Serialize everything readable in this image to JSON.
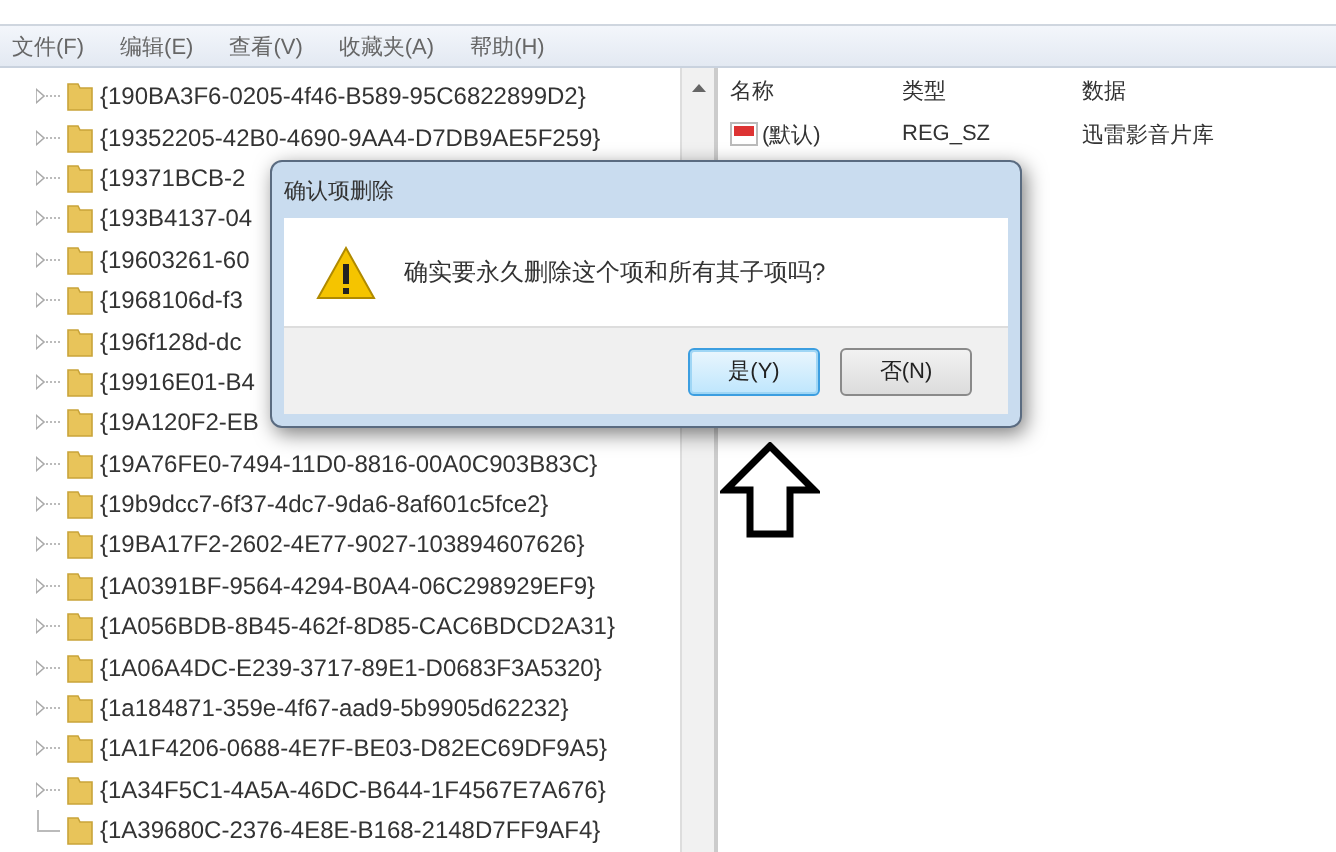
{
  "menu": [
    "文件(F)",
    "编辑(E)",
    "查看(V)",
    "收藏夹(A)",
    "帮助(H)"
  ],
  "tree": {
    "items": [
      {
        "label": "{190BA3F6-0205-4f46-B589-95C6822899D2}",
        "expandable": true
      },
      {
        "label": "{19352205-42B0-4690-9AA4-D7DB9AE5F259}",
        "expandable": true
      },
      {
        "label": "{19371BCB-2",
        "expandable": true
      },
      {
        "label": "{193B4137-04",
        "expandable": true
      },
      {
        "label": "{19603261-60",
        "expandable": true
      },
      {
        "label": "{1968106d-f3",
        "expandable": true
      },
      {
        "label": "{196f128d-dc",
        "expandable": true
      },
      {
        "label": "{19916E01-B4",
        "expandable": true
      },
      {
        "label": "{19A120F2-EB",
        "expandable": true
      },
      {
        "label": "{19A76FE0-7494-11D0-8816-00A0C903B83C}",
        "expandable": true
      },
      {
        "label": "{19b9dcc7-6f37-4dc7-9da6-8af601c5fce2}",
        "expandable": true
      },
      {
        "label": "{19BA17F2-2602-4E77-9027-103894607626}",
        "expandable": true
      },
      {
        "label": "{1A0391BF-9564-4294-B0A4-06C298929EF9}",
        "expandable": true
      },
      {
        "label": "{1A056BDB-8B45-462f-8D85-CAC6BDCD2A31}",
        "expandable": true
      },
      {
        "label": "{1A06A4DC-E239-3717-89E1-D0683F3A5320}",
        "expandable": true
      },
      {
        "label": "{1a184871-359e-4f67-aad9-5b9905d62232}",
        "expandable": true
      },
      {
        "label": "{1A1F4206-0688-4E7F-BE03-D82EC69DF9A5}",
        "expandable": true
      },
      {
        "label": "{1A34F5C1-4A5A-46DC-B644-1F4567E7A676}",
        "expandable": true
      },
      {
        "label": "{1A39680C-2376-4E8E-B168-2148D7FF9AF4}",
        "expandable": false
      }
    ]
  },
  "values": {
    "columns": [
      "名称",
      "类型",
      "数据"
    ],
    "rows": [
      {
        "name": "(默认)",
        "type": "REG_SZ",
        "data": "迅雷影音片库"
      }
    ]
  },
  "dialog": {
    "title": "确认项删除",
    "message": "确实要永久删除这个项和所有其子项吗?",
    "buttons": [
      {
        "label": "是(Y)",
        "selected": true
      },
      {
        "label": "否(N)",
        "selected": false
      }
    ]
  }
}
